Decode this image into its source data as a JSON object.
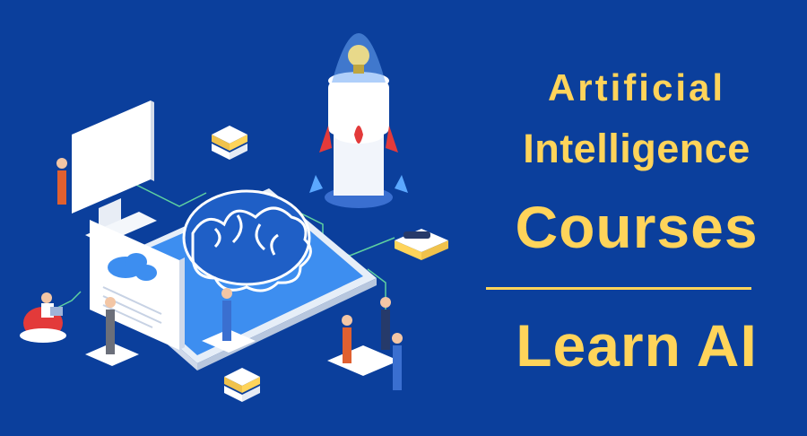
{
  "headline": {
    "line1": "Artificial",
    "line2": "Intelligence",
    "line3": "Courses",
    "line4": "Learn AI"
  },
  "colors": {
    "background": "#0b3f9c",
    "accent_text": "#ffd45a",
    "screen_blue": "#3d8ef0",
    "rocket_red": "#e33a3a"
  },
  "icons": [
    "brain-icon",
    "rocket-icon",
    "cloud-icon",
    "monitor-icon",
    "server-stack-icon",
    "smartphone-icon",
    "document-icon"
  ]
}
